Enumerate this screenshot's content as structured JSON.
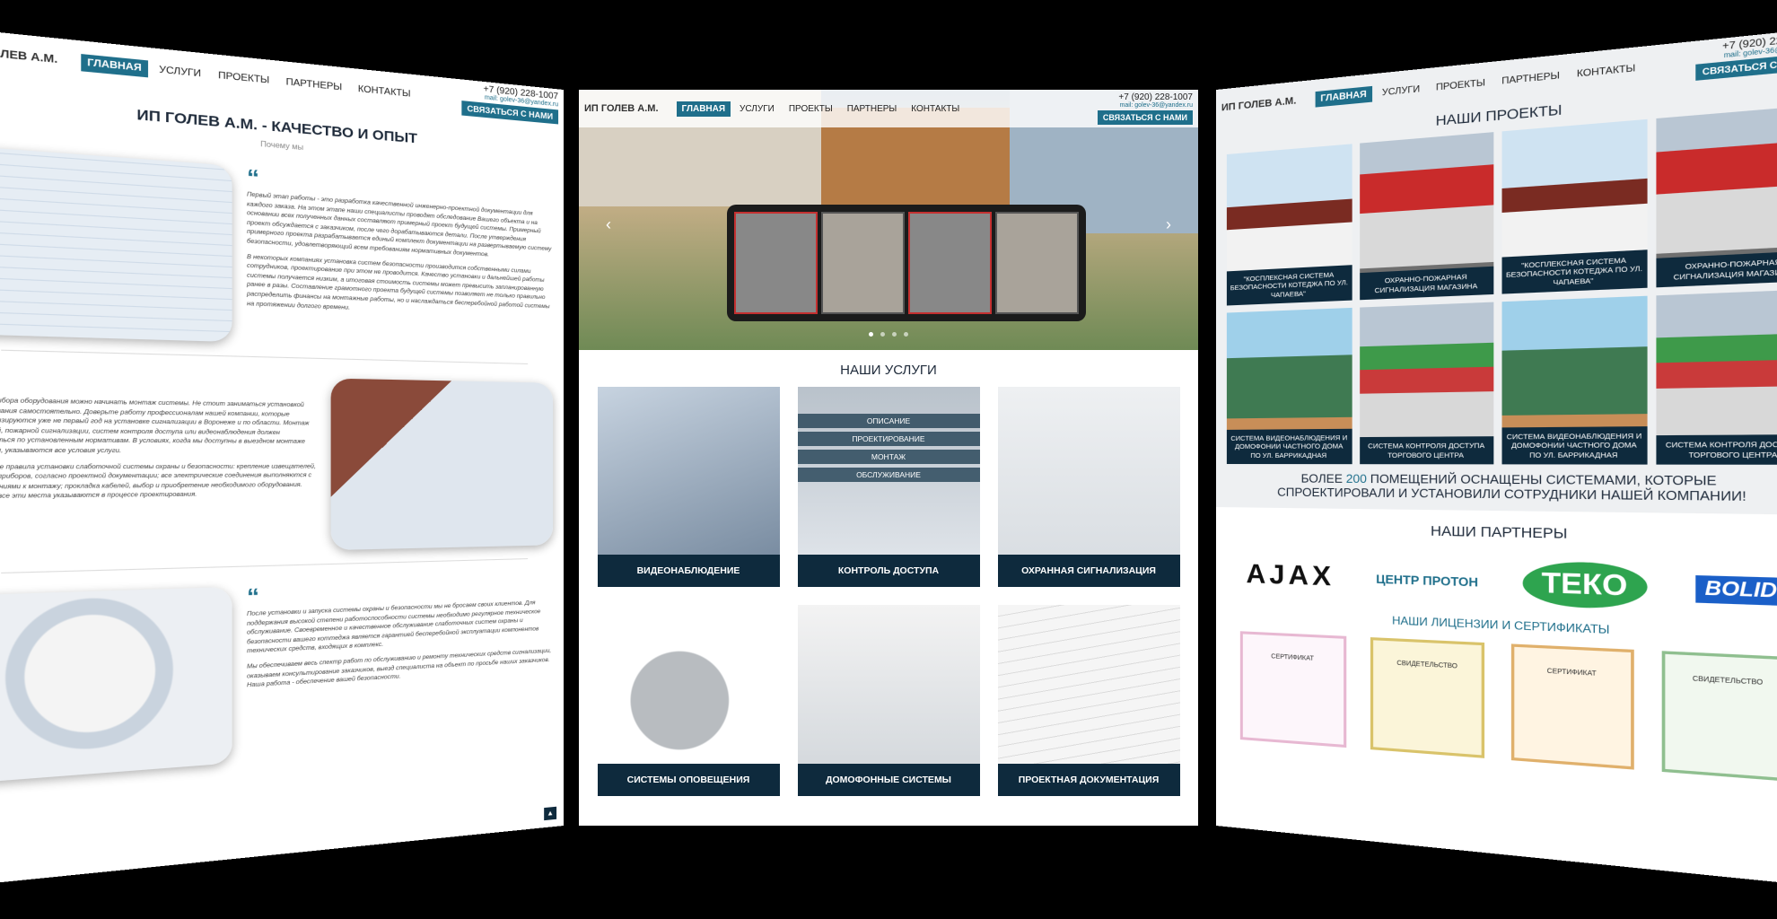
{
  "site": {
    "logo": "ИП ГОЛЕВ А.М.",
    "nav": [
      "ГЛАВНАЯ",
      "УСЛУГИ",
      "ПРОЕКТЫ",
      "ПАРТНЕРЫ",
      "КОНТАКТЫ"
    ],
    "phone": "+7 (920) 228-1007",
    "email": "mail: golev-36@yandex.ru",
    "callback": "СВЯЗАТЬСЯ С НАМИ"
  },
  "left": {
    "title": "ИП ГОЛЕВ А.М. - КАЧЕСТВО И ОПЫТ",
    "subtitle": "Почему мы",
    "sections": [
      {
        "text1": "Первый этап работы - это разработка качественной инженерно-проектной документации для каждого заказа. На этом этапе наши специалисты проводят обследование Вашего объекта и на основании всех полученных данных составляют примерный проект будущей системы. Примерный проект обсуждается с заказчиком, после чего дорабатываются детали. После утверждения примерного проекта разрабатывается единый комплект документации на развертываемую систему безопасности, удовлетворяющий всем требованиям нормативных документов.",
        "text2": "В некоторых компаниях установка систем безопасности производится собственными силами сотрудников, проектирование при этом не проводится. Качество установки и дальнейшей работы системы получается низким, а итоговая стоимость системы может превысить запланированную ранее в разы. Составление грамотного проекта будущей системы позволяет не только правильно распределить финансы на монтажные работы, но и наслаждаться бесперебойной работой системы на протяжении долгого времени."
      },
      {
        "text1": "После выбора оборудования можно начинать монтаж системы. Не стоит заниматься установкой оборудования самостоятельно. Доверьте работу профессионалам нашей компании, которые специализируются уже не первый год на установке сигнализации в Воронеже и по области. Монтаж охранной, пожарной сигнализации, систем контроля доступа или видеонаблюдения должен проводиться по установленным нормативам. В условиях, когда мы доступны в выездном монтаже системы, указываются все условия услуги.",
        "text2": "Основные правила установки слаботочной системы охраны и безопасности: крепление извещателей, камер и приборов, согласно проектной документации; все электрические соединения выполняются с требованиями к монтажу; прокладка кабелей, выбор и приобретение необходимого оборудования. Обычно все эти места указываются в процессе проектирования."
      },
      {
        "text1": "После установки и запуска системы охраны и безопасности мы не бросаем своих клиентов. Для поддержания высокой степени работоспособности системы необходимо регулярное техническое обслуживание. Своевременное и качественное обслуживание слаботочных систем охраны и безопасности вашего коттеджа является гарантией бесперебойной эксплуатации компонентов технических средств, входящих в комплекс.",
        "text2": "Мы обеспечиваем весь спектр работ по обслуживанию и ремонту технических средств сигнализации, оказываем консультирование заказчиков, выезд специалиста на объект по просьбе наших заказчиков. Наша работа - обеспечение вашей безопасности."
      }
    ]
  },
  "middle": {
    "services_title": "НАШИ УСЛУГИ",
    "access_menu": [
      "ОПИСАНИЕ",
      "ПРОЕКТИРОВАНИЕ",
      "МОНТАЖ",
      "ОБСЛУЖИВАНИЕ"
    ],
    "services": [
      "ВИДЕОНАБЛЮДЕНИЕ",
      "КОНТРОЛЬ ДОСТУПА",
      "ОХРАННАЯ СИГНАЛИЗАЦИЯ",
      "СИСТЕМЫ ОПОВЕЩЕНИЯ",
      "ДОМОФОННЫЕ СИСТЕМЫ",
      "ПРОЕКТНАЯ ДОКУМЕНТАЦИЯ"
    ],
    "slider_dots": 4
  },
  "right": {
    "projects_title": "НАШИ ПРОЕКТЫ",
    "projects": [
      "\"КОСПЛЕКСНАЯ СИСТЕМА БЕЗОПАСНОСТИ КОТЕДЖА ПО УЛ. ЧАПАЕВА\"",
      "ОХРАННО-ПОЖАРНАЯ СИГНАЛИЗАЦИЯ МАГАЗИНА",
      "\"КОСПЛЕКСНАЯ СИСТЕМА БЕЗОПАСНОСТИ КОТЕДЖА ПО УЛ. ЧАПАЕВА\"",
      "ОХРАННО-ПОЖАРНАЯ СИГНАЛИЗАЦИЯ МАГАЗИНА",
      "СИСТЕМА ВИДЕОНАБЛЮДЕНИЯ И ДОМОФОНИИ ЧАСТНОГО ДОМА ПО УЛ. БАРРИКАДНАЯ",
      "СИСТЕМА КОНТРОЛЯ ДОСТУПА ТОРГОВОГО ЦЕНТРА",
      "СИСТЕМА ВИДЕОНАБЛЮДЕНИЯ И ДОМОФОНИИ ЧАСТНОГО ДОМА ПО УЛ. БАРРИКАДНАЯ",
      "СИСТЕМА КОНТРОЛЯ ДОСТУПА ТОРГОВОГО ЦЕНТРА"
    ],
    "stats_pre": "БОЛЕЕ",
    "stats_num": "200",
    "stats_post": "ПОМЕЩЕНИЙ ОСНАЩЕНЫ СИСТЕМАМИ, КОТОРЫЕ СПРОЕКТИРОВАЛИ И УСТАНОВИЛИ СОТРУДНИКИ НАШЕЙ КОМПАНИИ!",
    "partners_title": "НАШИ ПАРТНЕРЫ",
    "partners": [
      "AJAX",
      "ЦЕНТР ПРОТОН",
      "ТЕКО",
      "BOLID"
    ],
    "licenses_title": "НАШИ ЛИЦЕНЗИИ И СЕРТИФИКАТЫ",
    "licenses": [
      "СЕРТИФИКАТ",
      "СВИДЕТЕЛЬСТВО",
      "СЕРТИФИКАТ",
      "СВИДЕТЕЛЬСТВО"
    ]
  }
}
